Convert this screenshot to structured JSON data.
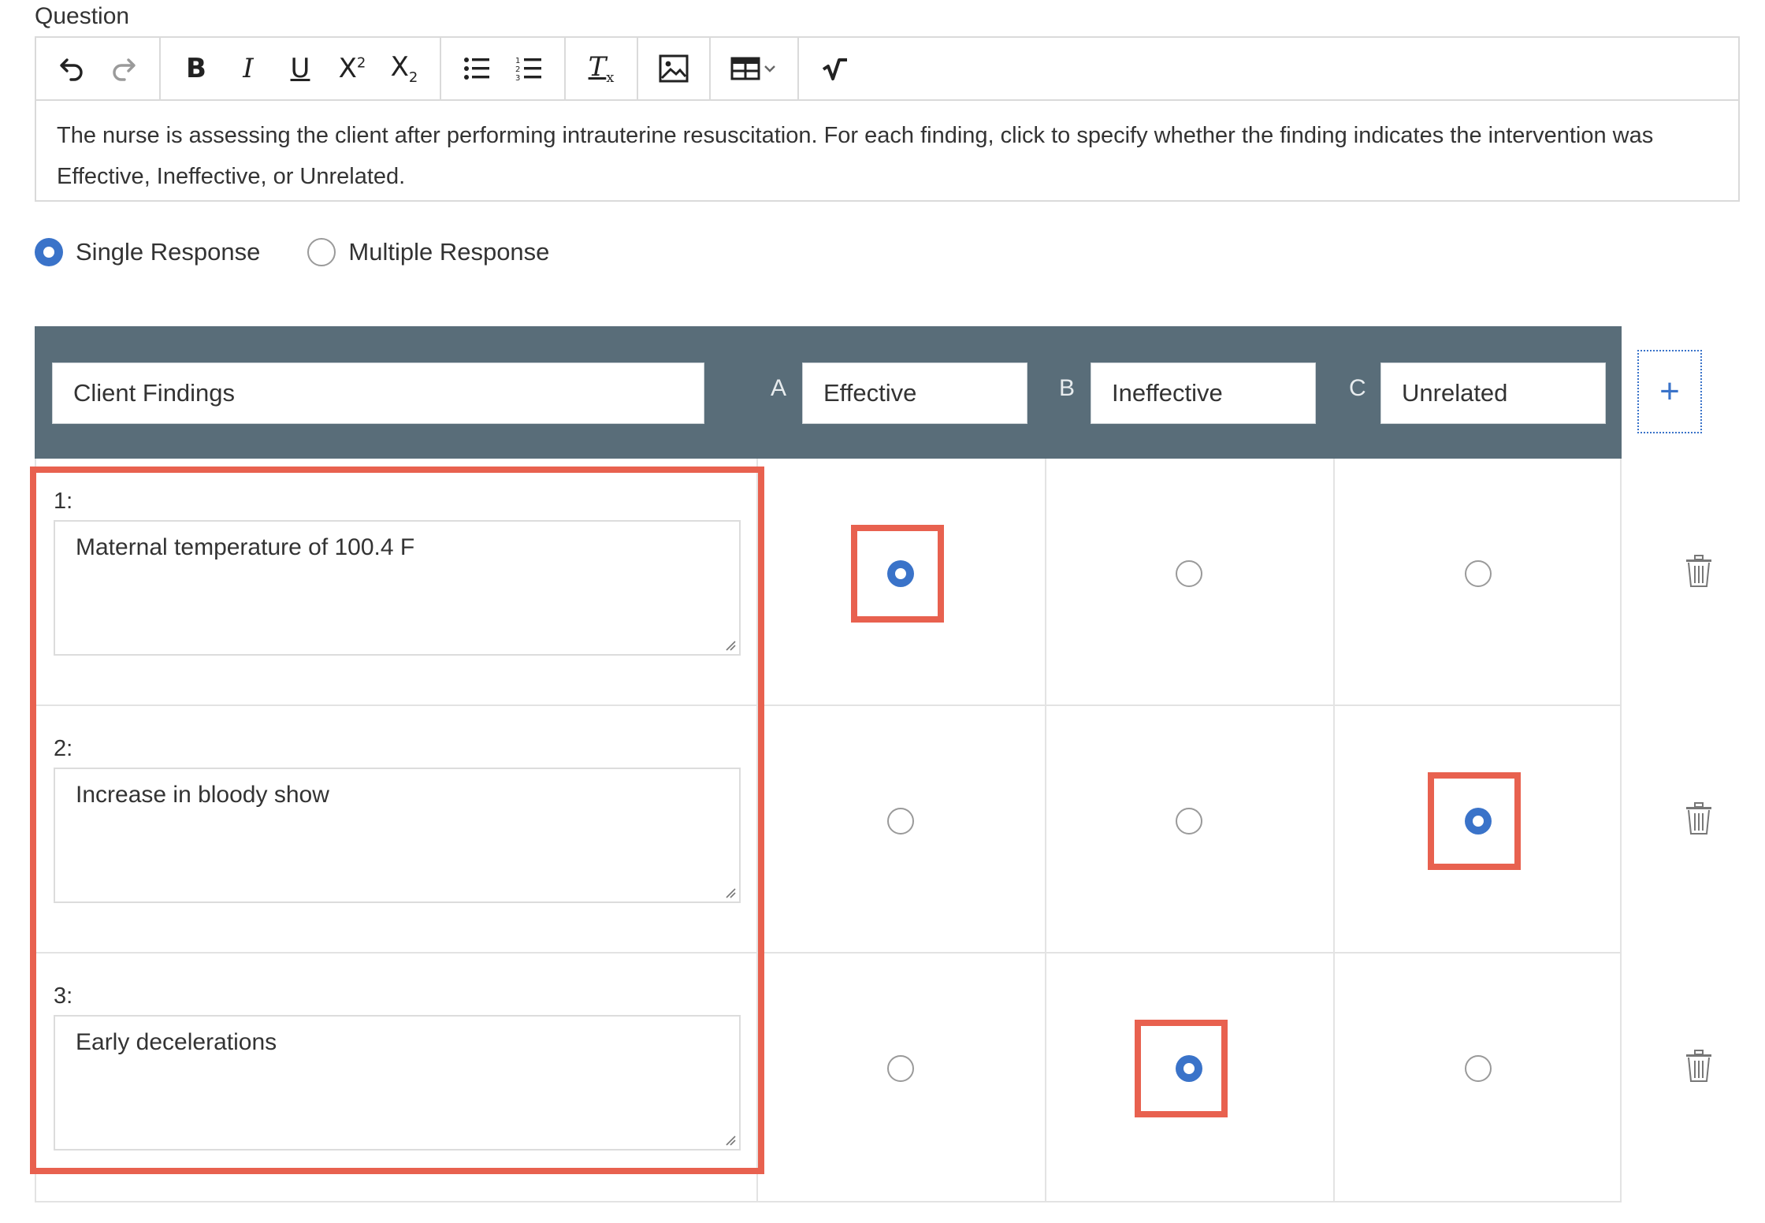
{
  "question": {
    "label": "Question",
    "text": "The nurse is assessing the client after performing intrauterine resuscitation. For each finding, click to specify whether the finding indicates the intervention was Effective, Ineffective, or Unrelated."
  },
  "toolbar": {
    "items": [
      "undo-icon",
      "redo-icon",
      "bold-icon",
      "italic-icon",
      "underline-icon",
      "superscript-icon",
      "subscript-icon",
      "bulleted-list-icon",
      "numbered-list-icon",
      "clear-formatting-icon",
      "image-icon",
      "table-icon",
      "math-icon"
    ]
  },
  "response_type": {
    "options": [
      {
        "label": "Single Response",
        "selected": true
      },
      {
        "label": "Multiple Response",
        "selected": false
      }
    ]
  },
  "matrix": {
    "header_label": "Client Findings",
    "columns": [
      {
        "letter": "A",
        "label": "Effective"
      },
      {
        "letter": "B",
        "label": "Ineffective"
      },
      {
        "letter": "C",
        "label": "Unrelated"
      }
    ],
    "add_column_icon": "plus-icon",
    "rows": [
      {
        "number": "1:",
        "text": "Maternal temperature of 100.4 F",
        "selected_column": "A"
      },
      {
        "number": "2:",
        "text": "Increase in bloody show",
        "selected_column": "C"
      },
      {
        "number": "3:",
        "text": "Early decelerations",
        "selected_column": "B"
      }
    ],
    "row_delete_icon": "trash-icon"
  },
  "annotations": {
    "highlight_color": "#e8614f"
  },
  "colors": {
    "accent": "#3a73c9",
    "header_bg": "#596d79"
  }
}
